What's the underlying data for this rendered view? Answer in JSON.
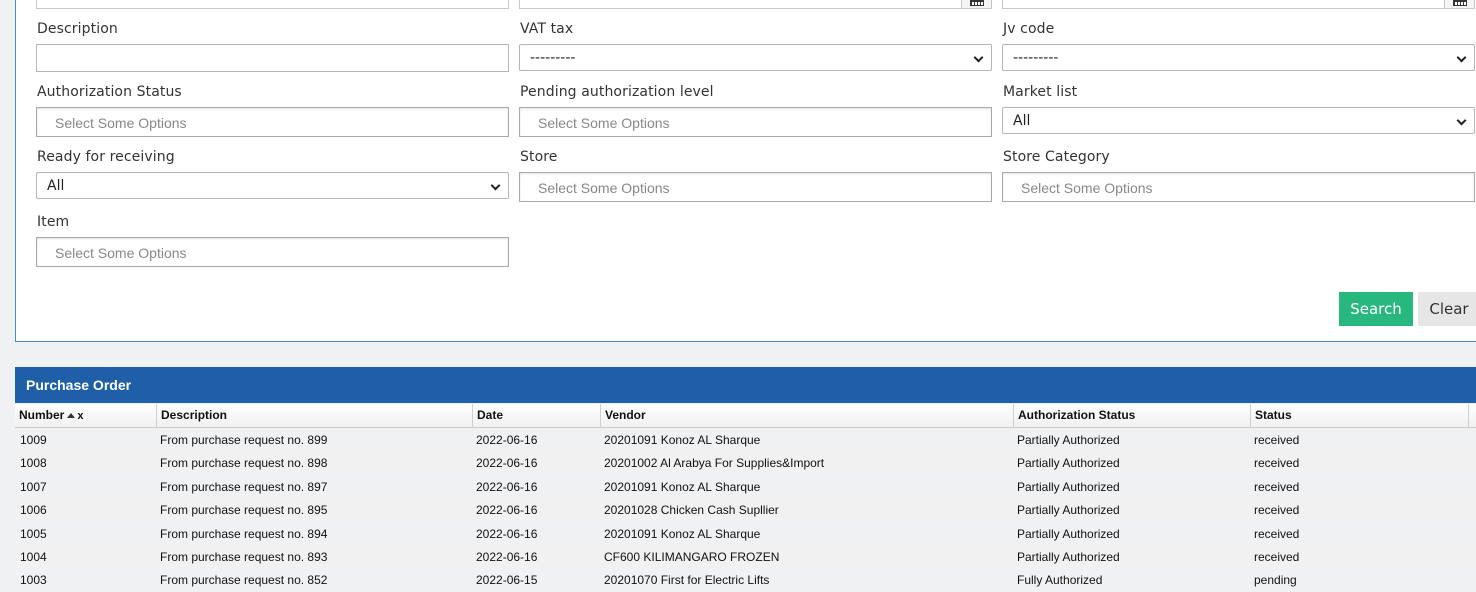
{
  "filters": {
    "description_label": "Description",
    "vat_tax_label": "VAT tax",
    "vat_tax_value": "---------",
    "jv_code_label": "Jv code",
    "jv_code_value": "---------",
    "authorization_status_label": "Authorization Status",
    "authorization_status_placeholder": "Select Some Options",
    "pending_level_label": "Pending authorization level",
    "pending_level_placeholder": "Select Some Options",
    "market_list_label": "Market list",
    "market_list_value": "All",
    "ready_receiving_label": "Ready for receiving",
    "ready_receiving_value": "All",
    "store_label": "Store",
    "store_placeholder": "Select Some Options",
    "store_category_label": "Store Category",
    "store_category_placeholder": "Select Some Options",
    "item_label": "Item",
    "item_placeholder": "Select Some Options"
  },
  "actions": {
    "search_label": "Search",
    "clear_label": "Clear"
  },
  "grid": {
    "title": "Purchase Order",
    "sort_remove_glyph": "x",
    "columns": [
      "Number",
      "Description",
      "Date",
      "Vendor",
      "Authorization Status",
      "Status"
    ],
    "rows": [
      {
        "number": "1009",
        "description": "From purchase request no. 899",
        "date": "2022-06-16",
        "vendor": "20201091 Konoz AL Sharque",
        "auth_status": "Partially Authorized",
        "status": "received"
      },
      {
        "number": "1008",
        "description": "From purchase request no. 898",
        "date": "2022-06-16",
        "vendor": "20201002 Al Arabya For Supplies&Import",
        "auth_status": "Partially Authorized",
        "status": "received"
      },
      {
        "number": "1007",
        "description": "From purchase request no. 897",
        "date": "2022-06-16",
        "vendor": "20201091 Konoz AL Sharque",
        "auth_status": "Partially Authorized",
        "status": "received"
      },
      {
        "number": "1006",
        "description": "From purchase request no. 895",
        "date": "2022-06-16",
        "vendor": "20201028 Chicken Cash Supllier",
        "auth_status": "Partially Authorized",
        "status": "received"
      },
      {
        "number": "1005",
        "description": "From purchase request no. 894",
        "date": "2022-06-16",
        "vendor": "20201091 Konoz AL Sharque",
        "auth_status": "Partially Authorized",
        "status": "received"
      },
      {
        "number": "1004",
        "description": "From purchase request no. 893",
        "date": "2022-06-16",
        "vendor": "CF600 KILIMANGARO FROZEN",
        "auth_status": "Partially Authorized",
        "status": "received"
      },
      {
        "number": "1003",
        "description": "From purchase request no. 852",
        "date": "2022-06-15",
        "vendor": "20201070 First for Electric Lifts",
        "auth_status": "Fully Authorized",
        "status": "pending"
      }
    ]
  },
  "colors": {
    "grid_header": "#1f5fa8",
    "search_button": "#27b77f",
    "clear_button": "#e6e6e6",
    "panel_border": "#4a90b8"
  }
}
